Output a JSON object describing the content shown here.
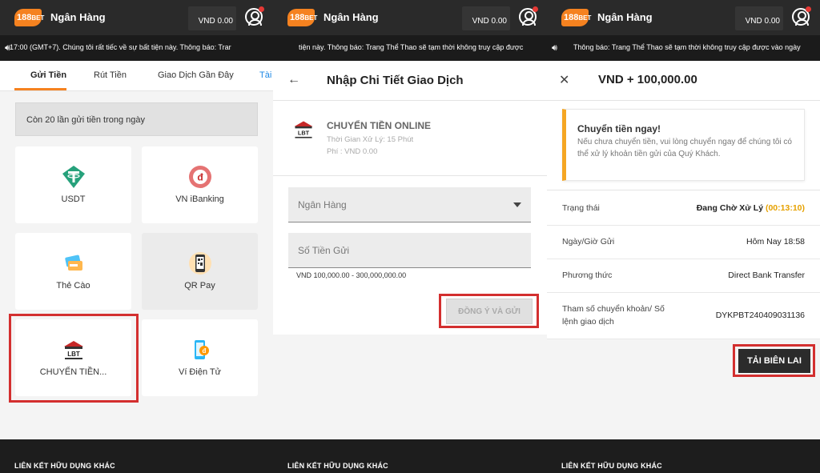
{
  "colors": {
    "accent": "#f58220",
    "highlight": "#d32f2f",
    "topbar": "#2a2a2a",
    "ticker": "#1b1b1b",
    "timer": "#e6a100",
    "link": "#1e88e5"
  },
  "header": {
    "logo_main": "188",
    "logo_sub": "BET",
    "title": "Ngân Hàng",
    "balance": "VND 0.00",
    "user_icon": "user-circle-icon"
  },
  "ticker": {
    "icon": "speaker-icon",
    "p1": "17:00 (GMT+7). Chúng tôi rất tiếc về sự bất tiện này.     Thông báo: Trar",
    "p2": "tiện này.     Thông báo: Trang Thể Thao sẽ tạm thời không truy cập được",
    "p3": "Thông báo: Trang Thể Thao sẽ tạm thời không truy cập được vào ngày"
  },
  "panel1": {
    "tabs": [
      {
        "label": "Gửi Tiền",
        "active": true
      },
      {
        "label": "Rút Tiền",
        "active": false
      },
      {
        "label": "Giao Dịch Gần Đây",
        "active": false
      },
      {
        "label": "Tài",
        "active": false
      }
    ],
    "notice": "Còn 20 lần gửi tiền trong ngày",
    "methods": [
      {
        "label": "USDT",
        "icon": "tether-icon"
      },
      {
        "label": "VN iBanking",
        "icon": "dong-coin-icon"
      },
      {
        "label": "Thẻ Cào",
        "icon": "scratch-card-icon"
      },
      {
        "label": "QR Pay",
        "icon": "qr-phone-icon"
      },
      {
        "label": "CHUYỂN TIỀN...",
        "icon": "lbt-bank-icon"
      },
      {
        "label": "Ví Điện Tử",
        "icon": "e-wallet-icon"
      }
    ]
  },
  "panel2": {
    "back_icon": "arrow-left-icon",
    "title": "Nhập Chi Tiết Giao Dịch",
    "method_name": "CHUYỂN TIỀN ONLINE",
    "processing": "Thời Gian Xử Lý: 15 Phút",
    "fee": "Phí : VND 0.00",
    "bank_placeholder": "Ngân Hàng",
    "amount_placeholder": "Số Tiền Gửi",
    "range_hint": "VND 100,000.00 - 300,000,000.00",
    "submit_label": "ĐỒNG Ý VÀ GỬI"
  },
  "panel3": {
    "close_icon": "close-icon",
    "title": "VND + 100,000.00",
    "alert_title": "Chuyển tiền ngay!",
    "alert_body": "Nếu chưa chuyển tiền, vui lòng chuyển ngay để chúng tôi có thể xử lý khoản tiền gửi của Quý Khách.",
    "rows": [
      {
        "key": "Trạng thái",
        "value": "Đang Chờ Xử Lý",
        "extra": "(00:13:10)"
      },
      {
        "key": "Ngày/Giờ Gửi",
        "value": "Hôm Nay 18:58"
      },
      {
        "key": "Phương thức",
        "value": "Direct Bank Transfer"
      },
      {
        "key": "Tham số chuyển khoản/ Số lệnh giao dịch",
        "value": "DYKPBT240409031136"
      }
    ],
    "download_label": "TẢI BIÊN LAI"
  },
  "footer": {
    "links_title": "LIÊN KẾT HỮU DỤNG KHÁC"
  }
}
